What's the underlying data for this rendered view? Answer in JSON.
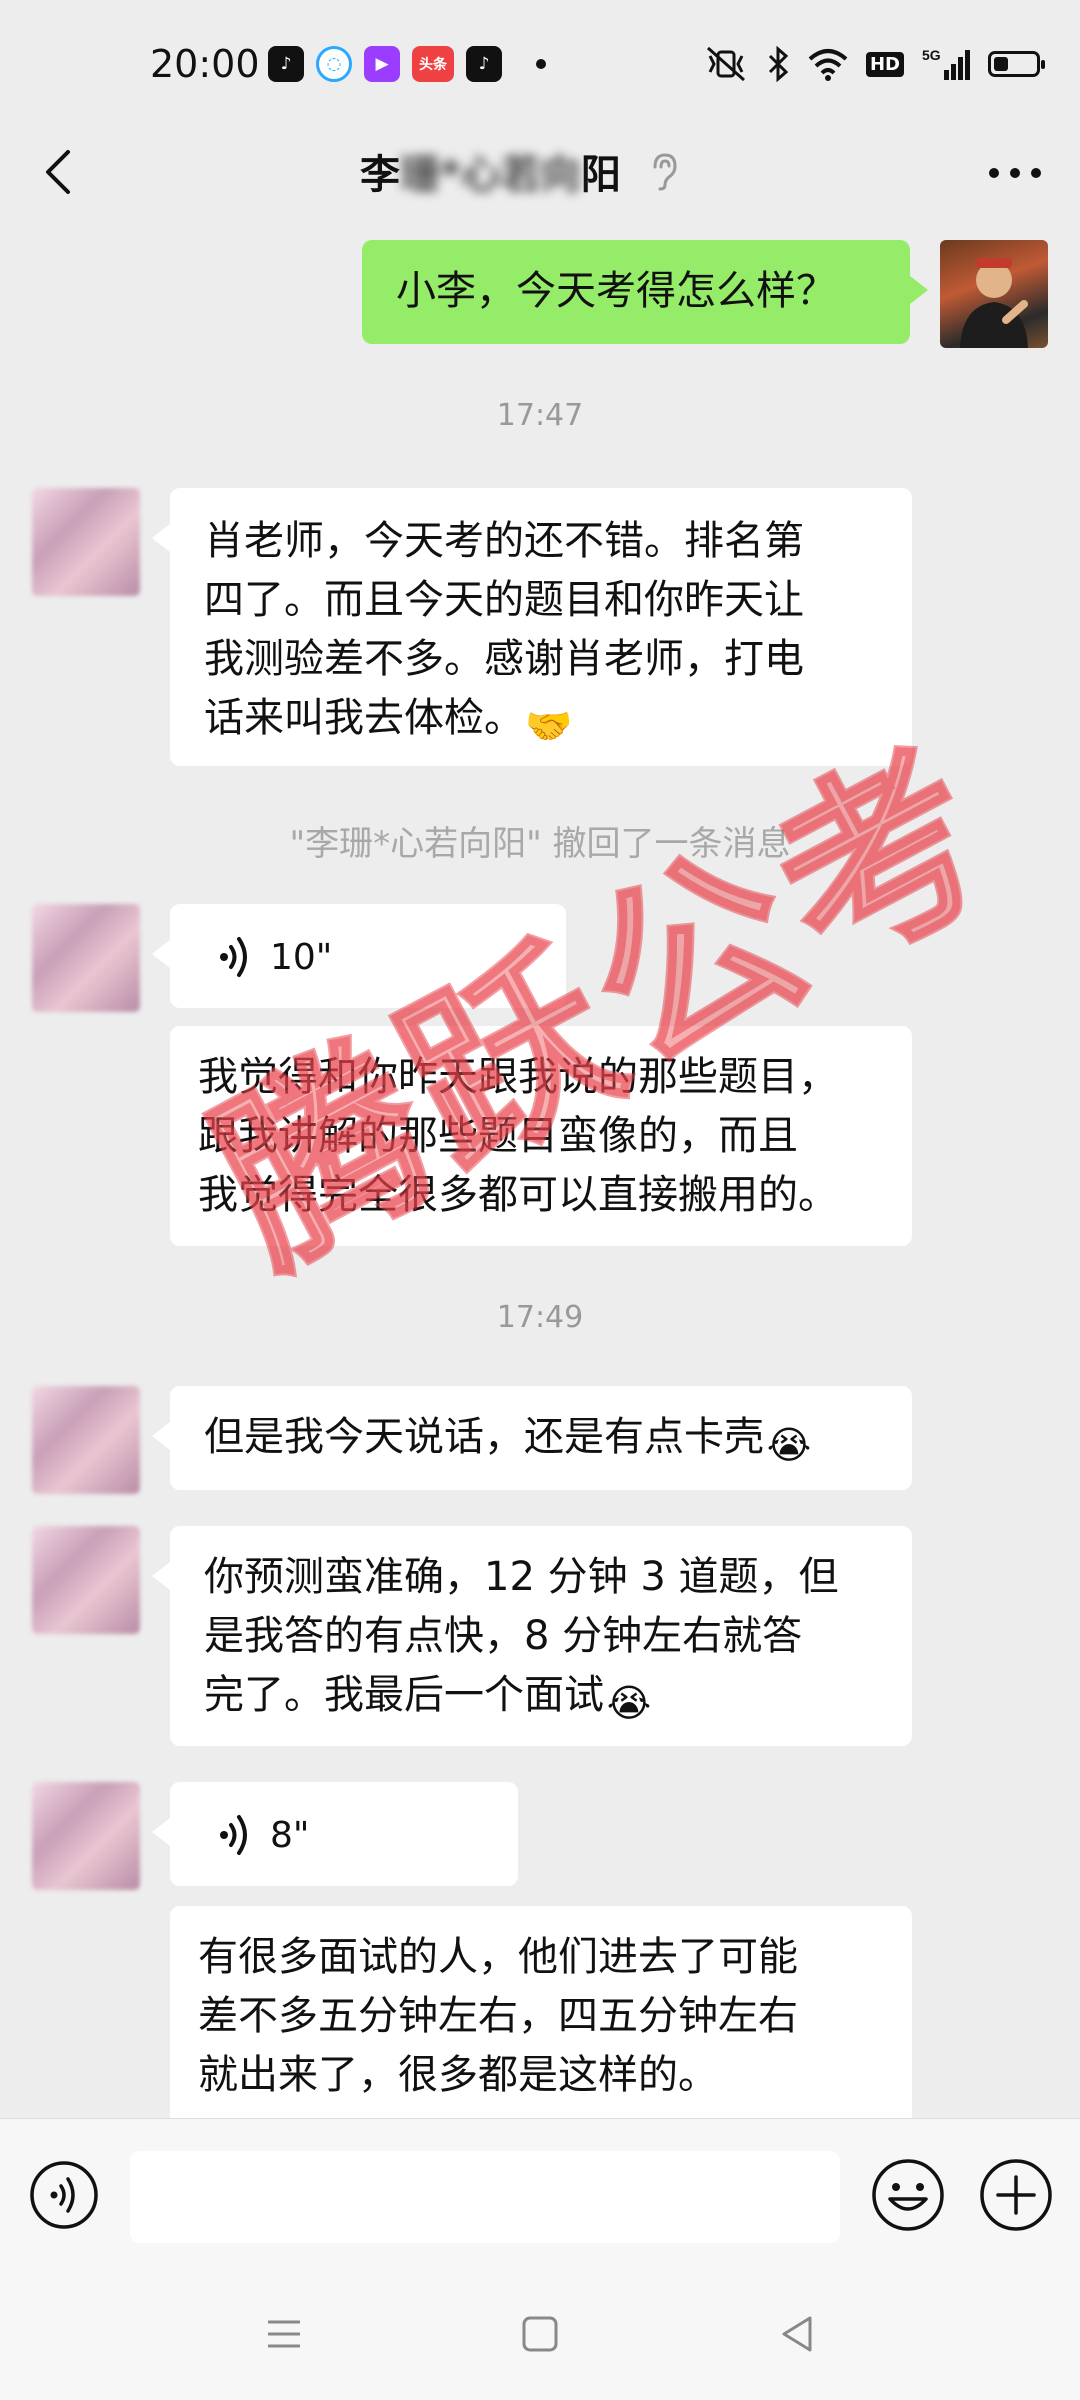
{
  "status_bar": {
    "time": "20:00",
    "apps": [
      {
        "icon": "douyin-icon",
        "color": "#111111",
        "glyph": "♪"
      },
      {
        "icon": "qq-browser-icon",
        "color": "#2aa7ff",
        "glyph": "◌"
      },
      {
        "icon": "video-player-icon",
        "color": "#9b3dff",
        "glyph": "▶"
      },
      {
        "icon": "toutiao-icon",
        "color": "#f04142",
        "glyph": "头条"
      },
      {
        "icon": "douyin-lite-icon",
        "color": "#111111",
        "glyph": "♪"
      }
    ],
    "network": "5G",
    "hd": "HD",
    "battery_level": 0.35
  },
  "header": {
    "title_prefix": "李",
    "title_obscured": "珊*心若向",
    "title_suffix": "阳"
  },
  "messages": {
    "m1_me": "小李，今天考得怎么样？",
    "ts1": "17:47",
    "m2_line1": "肖老师，今天考的还不错。排名第",
    "m2_line2": "四了。而且今天的题目和你昨天让",
    "m2_line3": "我测验差不多。感谢肖老师，打电",
    "m2_line4": "话来叫我去体检。",
    "m2_emoji": "🤝",
    "recall": "\"李珊*心若向阳\" 撤回了一条消息",
    "voice1": "10\"",
    "m3_line1": "我觉得和你昨天跟我说的那些题目，",
    "m3_line2": "跟我讲解的那些题目蛮像的，而且",
    "m3_line3": "我觉得完全很多都可以直接搬用的。",
    "ts2": "17:49",
    "m4_text": "但是我今天说话，还是有点卡壳",
    "m4_emoji": "😭",
    "m5_line1": "你预测蛮准确，12 分钟 3 道题，但",
    "m5_line2": "是我答的有点快，8 分钟左右就答",
    "m5_line3": "完了。我最后一个面试",
    "m5_emoji": "😭",
    "voice2": "8\"",
    "m6_line1": "有很多面试的人，他们进去了可能",
    "m6_line2": "差不多五分钟左右，四五分钟左右",
    "m6_line3": "就出来了，很多都是这样的。"
  },
  "watermark": "腾跃公考",
  "input": {
    "placeholder": ""
  },
  "colors": {
    "bg": "#ededed",
    "my_bubble": "#95ec69",
    "other_bubble": "#ffffff",
    "watermark": "#eb5055"
  }
}
